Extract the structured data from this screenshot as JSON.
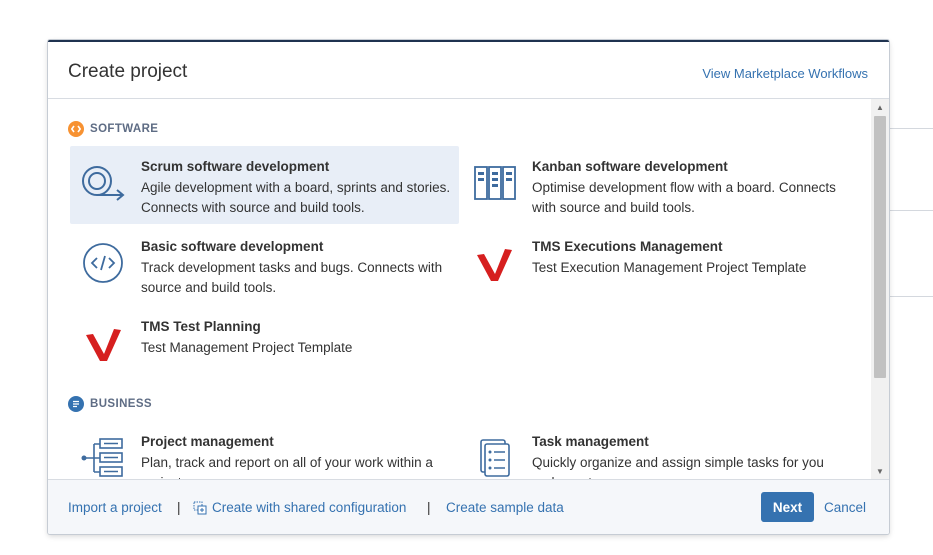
{
  "dialog": {
    "title": "Create project",
    "marketplace_link": "View Marketplace Workflows"
  },
  "sections": {
    "software": {
      "label": "SOFTWARE",
      "icon": "code-circle-icon",
      "color": "#f79232"
    },
    "business": {
      "label": "BUSINESS",
      "icon": "document-circle-icon",
      "color": "#3572b0"
    }
  },
  "templates": {
    "scrum": {
      "name": "Scrum software development",
      "description": "Agile development with a board, sprints and stories. Connects with source and build tools.",
      "icon": "scrum-cycle-icon",
      "selected": true
    },
    "kanban": {
      "name": "Kanban software development",
      "description": "Optimise development flow with a board. Connects with source and build tools.",
      "icon": "kanban-board-icon"
    },
    "basic": {
      "name": "Basic software development",
      "description": "Track development tasks and bugs. Connects with source and build tools.",
      "icon": "code-brackets-icon"
    },
    "tms_exec": {
      "name": "TMS Executions Management",
      "description": "Test Execution Management Project Template",
      "icon": "red-v-icon"
    },
    "tms_test": {
      "name": "TMS Test Planning",
      "description": "Test Management Project Template",
      "icon": "red-v-icon"
    },
    "project_mgmt": {
      "name": "Project management",
      "description": "Plan, track and report on all of your work within a project.",
      "icon": "project-tree-icon"
    },
    "task_mgmt": {
      "name": "Task management",
      "description": "Quickly organize and assign simple tasks for you and your team.",
      "icon": "task-list-icon"
    }
  },
  "footer": {
    "import_label": "Import a project",
    "shared_config_label": "Create with shared configuration",
    "sample_label": "Create sample data",
    "separator": "|",
    "next_label": "Next",
    "cancel_label": "Cancel"
  },
  "colors": {
    "link": "#3572b0",
    "primary_button": "#3572b0",
    "selected_card": "#e8eef7",
    "tms_red": "#d61f1f"
  }
}
